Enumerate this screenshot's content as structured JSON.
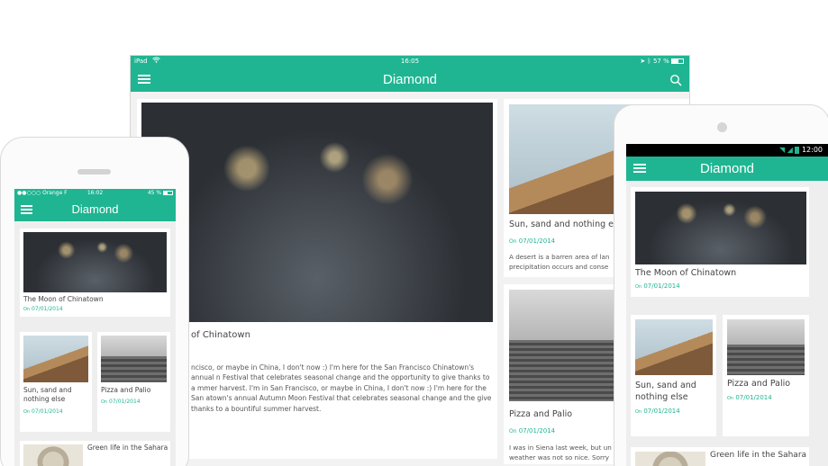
{
  "app": {
    "name": "Diamond",
    "accent": "#1fb592"
  },
  "tablet": {
    "status": {
      "device": "iPad",
      "time": "16:05",
      "battery": "57 %"
    },
    "title": "Diamond",
    "feature": {
      "title": "of Chinatown",
      "body": "ncisco, or maybe in China, I don't now :) I'm here for the San Francisco Chinatown's annual n Festival that celebrates seasonal change and the opportunity to give thanks to a mmer harvest. I'm in San Francisco, or maybe in China, I don't now :) I'm here for the San atown's annual Autumn Moon Festival that celebrates seasonal change and the give thanks to a bountiful summer harvest."
    },
    "cards": [
      {
        "title": "Sun, sand and nothing e",
        "date_prefix": "On",
        "date": "07/01/2014",
        "body_line1": "A desert is a barren area of lan",
        "body_line2": "precipitation occurs and conse"
      },
      {
        "title": "Pizza and Palio",
        "date_prefix": "On",
        "date": "07/01/2014",
        "body_line1": "I was in Siena last week, but un",
        "body_line2": "weather was not so nice. Sorry"
      }
    ]
  },
  "iphone": {
    "status": {
      "carrier": "Orange F",
      "time": "16:02",
      "battery": "45 %"
    },
    "title": "Diamond",
    "cards": [
      {
        "title": "The Moon of Chinatown",
        "date_prefix": "On",
        "date": "07/01/2014"
      },
      {
        "title": "Sun, sand and nothing else",
        "date_prefix": "On",
        "date": "07/01/2014"
      },
      {
        "title": "Pizza and Palio",
        "date_prefix": "On",
        "date": "07/01/2014"
      },
      {
        "title": "Green life in the Sahara"
      }
    ]
  },
  "android": {
    "status": {
      "time": "12:00"
    },
    "title": "Diamond",
    "cards": [
      {
        "title": "The Moon of Chinatown",
        "date_prefix": "On",
        "date": "07/01/2014"
      },
      {
        "title": "Sun, sand and nothing else",
        "date_prefix": "On",
        "date": "07/01/2014"
      },
      {
        "title": "Pizza and Palio",
        "date_prefix": "On",
        "date": "07/01/2014"
      },
      {
        "title": "Green life in the Sahara"
      }
    ]
  }
}
